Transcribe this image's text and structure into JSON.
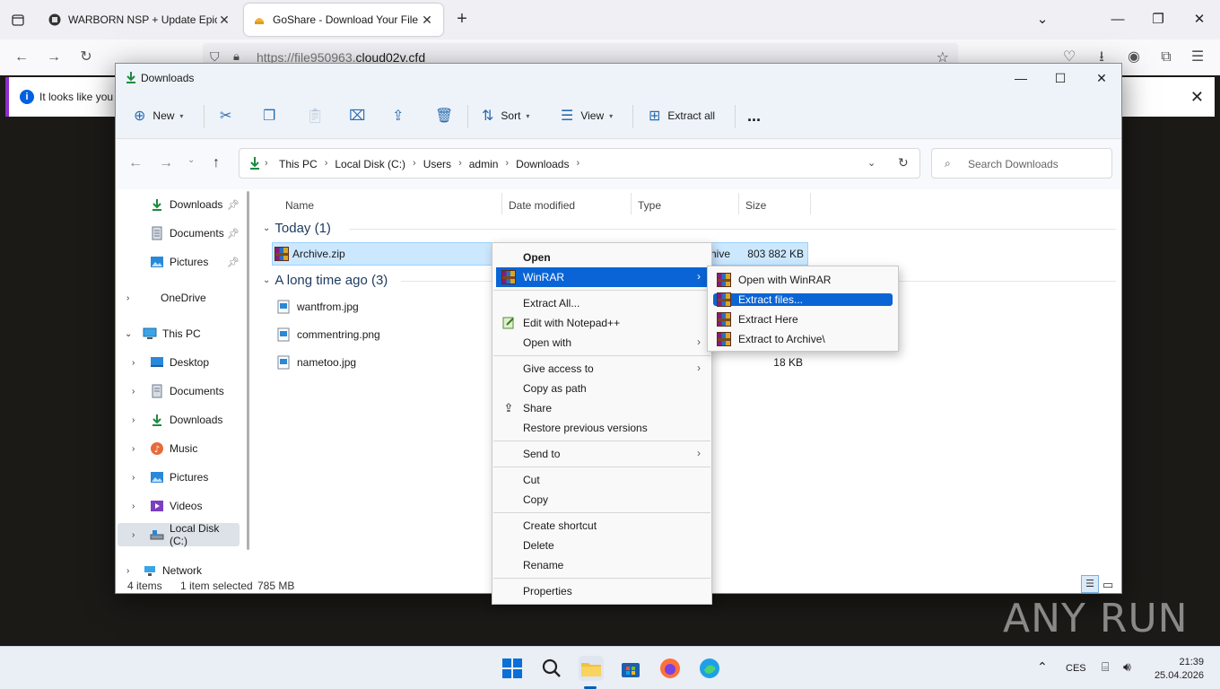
{
  "browser": {
    "tabs": [
      {
        "title": "WARBORN NSP + Update Epic N"
      },
      {
        "title": "GoShare - Download Your File"
      }
    ],
    "url_prefix": "https://file950963.",
    "url_domain": "cloud02v.cfd",
    "notification": "It looks like you h"
  },
  "explorer": {
    "title": "Downloads",
    "toolbar": {
      "new": "New",
      "sort": "Sort",
      "view": "View",
      "extract_all": "Extract all",
      "more": "..."
    },
    "breadcrumbs": [
      "This PC",
      "Local Disk (C:)",
      "Users",
      "admin",
      "Downloads"
    ],
    "search_placeholder": "Search Downloads",
    "sidebar": [
      {
        "label": "Downloads",
        "icon": "download-icon",
        "pinned": true
      },
      {
        "label": "Documents",
        "icon": "document-icon",
        "pinned": true
      },
      {
        "label": "Pictures",
        "icon": "picture-icon",
        "pinned": true
      },
      {
        "label": "OneDrive",
        "icon": "cloud-icon"
      },
      {
        "label": "This PC",
        "icon": "computer-icon"
      },
      {
        "label": "Desktop",
        "icon": "desktop-icon"
      },
      {
        "label": "Documents",
        "icon": "document-icon"
      },
      {
        "label": "Downloads",
        "icon": "download-icon"
      },
      {
        "label": "Music",
        "icon": "music-icon"
      },
      {
        "label": "Pictures",
        "icon": "picture-icon"
      },
      {
        "label": "Videos",
        "icon": "video-icon"
      },
      {
        "label": "Local Disk (C:)",
        "icon": "drive-icon",
        "selected": true
      },
      {
        "label": "Network",
        "icon": "network-icon"
      }
    ],
    "columns": {
      "name": "Name",
      "date": "Date modified",
      "type": "Type",
      "size": "Size"
    },
    "groups": [
      {
        "label": "Today (1)"
      },
      {
        "label": "A long time ago (3)"
      }
    ],
    "files": [
      {
        "name": "Archive.zip",
        "type": "hive",
        "size": "803 882 KB",
        "selected": true
      },
      {
        "name": "wantfrom.jpg",
        "type": "",
        "size": ""
      },
      {
        "name": "commentring.png",
        "type": "",
        "size": ""
      },
      {
        "name": "nametoo.jpg",
        "type": "",
        "size": "18 KB"
      }
    ],
    "status": {
      "items": "4 items",
      "selected": "1 item selected",
      "size": "785 MB"
    }
  },
  "context_menu": {
    "items": [
      {
        "label": "Open",
        "bold": true
      },
      {
        "label": "WinRAR",
        "submenu": true,
        "highlighted": true
      },
      {
        "label": "Extract All..."
      },
      {
        "label": "Edit with Notepad++"
      },
      {
        "label": "Open with",
        "submenu": true
      },
      {
        "label": "Give access to",
        "submenu": true
      },
      {
        "label": "Copy as path"
      },
      {
        "label": "Share"
      },
      {
        "label": "Restore previous versions"
      },
      {
        "label": "Send to",
        "submenu": true
      },
      {
        "label": "Cut"
      },
      {
        "label": "Copy"
      },
      {
        "label": "Create shortcut"
      },
      {
        "label": "Delete"
      },
      {
        "label": "Rename"
      },
      {
        "label": "Properties"
      }
    ]
  },
  "winrar_submenu": {
    "items": [
      {
        "label": "Open with WinRAR"
      },
      {
        "label": "Extract files...",
        "highlighted": true
      },
      {
        "label": "Extract Here"
      },
      {
        "label": "Extract to Archive\\"
      }
    ]
  },
  "watermark": "ANY RUN",
  "taskbar": {
    "lang": "CES",
    "time": "21:39",
    "date": "25.04.2026"
  },
  "colors": {
    "accent": "#0a64d6",
    "selection": "#cce8ff"
  }
}
